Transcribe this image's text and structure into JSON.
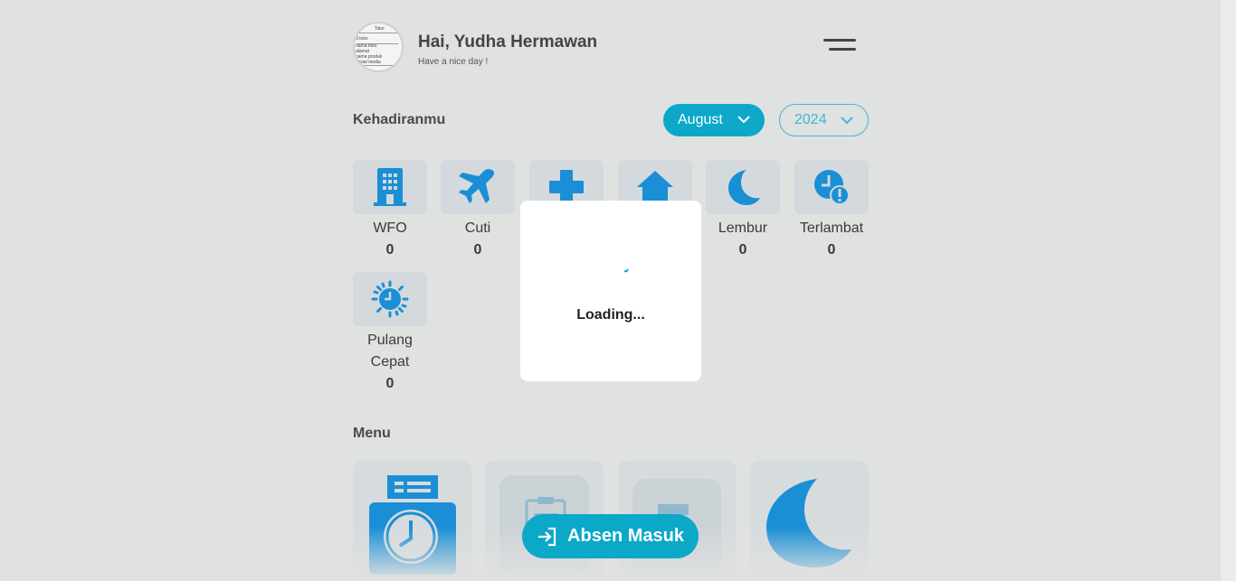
{
  "header": {
    "greeting": "Hai, Yudha Hermawan",
    "subgreeting": "Have a nice day !",
    "avatar_lines": [
      "Toko",
      "d toko",
      "nama toko",
      "alamat",
      "nama produk",
      "sosial media"
    ]
  },
  "attendance": {
    "title": "Kehadiranmu",
    "month_select": "August",
    "year_select": "2024",
    "stats": [
      {
        "label": "WFO",
        "count": "0",
        "icon": "office-building-icon"
      },
      {
        "label": "Cuti",
        "count": "0",
        "icon": "airplane-icon"
      },
      {
        "label": "",
        "count": "",
        "icon": "medical-cross-icon"
      },
      {
        "label": "",
        "count": "",
        "icon": "home-icon"
      },
      {
        "label": "Lembur",
        "count": "0",
        "icon": "moon-icon"
      },
      {
        "label": "Terlambat",
        "count": "0",
        "icon": "clock-alert-icon"
      },
      {
        "label": "Pulang\nCepat",
        "count": "0",
        "icon": "sun-clock-icon"
      }
    ]
  },
  "menu": {
    "title": "Menu",
    "cards": [
      {
        "icon": "time-clock-machine-icon"
      },
      {
        "icon": "clipboard-icon"
      },
      {
        "icon": "document-icon"
      },
      {
        "icon": "moon-icon"
      }
    ]
  },
  "absen_button": {
    "label": "Absen Masuk",
    "icon": "login-arrow-icon"
  },
  "loading": {
    "text": "Loading..."
  },
  "colors": {
    "accent": "#0ba8c8",
    "icon_blue": "#1a8fd6",
    "background": "#e0e1e1"
  }
}
